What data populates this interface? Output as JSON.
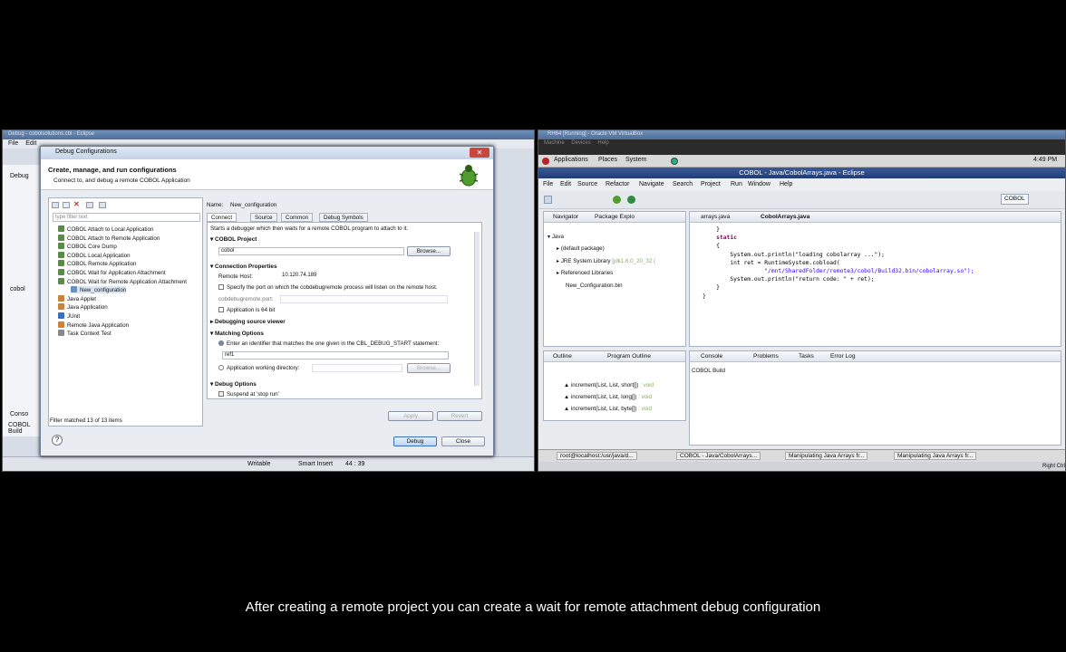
{
  "left_window": {
    "title": "Debug - cobolsolutions.cbl - Eclipse",
    "menu": [
      "File",
      "Edit"
    ],
    "side_tab": "Debug",
    "side_tab2": "cobol",
    "side_tab3": "Conso",
    "side_tab4": "COBOL Build",
    "status": {
      "mode": "Writable",
      "insert": "Smart Insert",
      "pos": "44 : 39"
    }
  },
  "dialog": {
    "title": "Debug Configurations",
    "heading": "Create, manage, and run configurations",
    "subheading": "Connect to, and debug a remote COBOL Application",
    "filter_placeholder": "type filter text",
    "tree": [
      "COBOL Attach to Local Application",
      "COBOL Attach to Remote Application",
      "COBOL Core Dump",
      "COBOL Local Application",
      "COBOL Remote Application",
      "COBOL Wait for Application Attachment",
      "COBOL Wait for Remote Application Attachment",
      "New_configuration",
      "Java Applet",
      "Java Application",
      "JUnit",
      "Remote Java Application",
      "Task Context Test"
    ],
    "filter_status": "Filter matched 13 of 13 items",
    "name_label": "Name:",
    "name_value": "New_configuration",
    "tabs": [
      "Connect",
      "Source",
      "Common",
      "Debug Symbols"
    ],
    "description": "Starts a debugger which then waits for a remote COBOL program to attach to it.",
    "cobol_project_label": "COBOL Project",
    "project_value": "cobol",
    "browse_label": "Browse...",
    "connection_label": "Connection Properties",
    "remote_host_label": "Remote Host:",
    "remote_host_value": "10.120.74.189",
    "port_check_label": "Specify the port on which the cobdebugremote process will listen on the remote host.",
    "port_label": "cobdebugremote port:",
    "app64_label": "Application is 64 bit",
    "debug_source_label": "Debugging source viewer",
    "matching_label": "Matching Options",
    "identifier_label": "Enter an identifier that matches the one given in the CBL_DEBUG_START statement:",
    "identifier_value": "ref1",
    "workdir_label": "Application working directory:",
    "workdir_browse": "Browse...",
    "debug_options_label": "Debug Options",
    "suspend_label": "Suspend at 'stop run'",
    "apply_label": "Apply",
    "revert_label": "Revert",
    "debug_label": "Debug",
    "close_label": "Close",
    "help_icon": "?"
  },
  "right_window": {
    "vb_title": "RH64 [Running] - Oracle VM VirtualBox",
    "vb_menu": [
      "Machine",
      "Devices",
      "Help"
    ],
    "gnome_menu": [
      "Applications",
      "Places",
      "System"
    ],
    "clock": "4:49 PM",
    "eclipse_title": "COBOL - Java/CobolArrays.java - Eclipse",
    "menu": [
      "File",
      "Edit",
      "Source",
      "Refactor",
      "Navigate",
      "Search",
      "Project",
      "Run",
      "Window",
      "Help"
    ],
    "perspective": "COBOL",
    "nav_tabs": [
      "Navigator",
      "Package Explo"
    ],
    "tree": [
      "Java",
      "(default package)",
      "JRE System Library",
      "[jdk1.6.0_20_32 (",
      "Referenced Libraries",
      "New_Configuration.bin"
    ],
    "editor_tabs": [
      "arrays.java",
      "CobolArrays.java"
    ],
    "code": [
      "    }",
      "",
      "    static",
      "    {",
      "        System.out.println(\"loading cobolarray ...\");",
      "        int ret = RuntimeSystem.cobload(",
      "                  \"/mnt/SharedFolder/remote3/cobol/Build32.bin/cobolarray.so\");",
      "        System.out.println(\"return code: \" + ret);",
      "    }",
      "",
      "}"
    ],
    "outline_tabs": [
      "Outline",
      "Program Outline"
    ],
    "outline_items": [
      {
        "name": "increment(List, List, short[])",
        "type": ": void"
      },
      {
        "name": "increment(List, List, long[])",
        "type": ": void"
      },
      {
        "name": "increment(List, List, byte[])",
        "type": ": void"
      }
    ],
    "console_tabs": [
      "Console",
      "Problems",
      "Tasks",
      "Error Log"
    ],
    "console_text": "COBOL Build",
    "taskbar": [
      "root@localhost:/usr/java/d...",
      "COBOL - Java/CobolArrays...",
      "Manipulating Java Arrays fr...",
      "Manipulating Java Arrays fr..."
    ],
    "right_ctrl": "Right Ctrl"
  },
  "caption": "After creating a remote project you can create a wait for remote attachment debug configuration"
}
